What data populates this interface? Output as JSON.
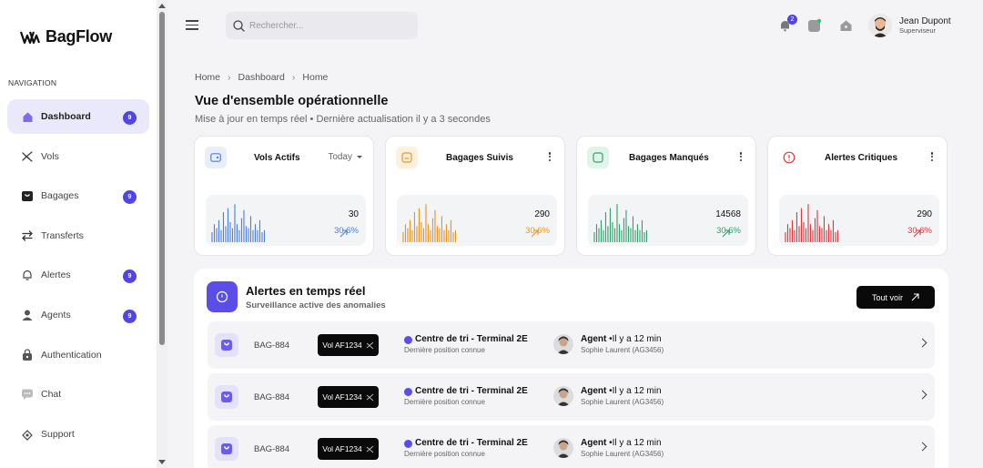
{
  "app": {
    "name": "BagFlow"
  },
  "sidebar": {
    "section_label": "NAVIGATION",
    "items": [
      {
        "label": "Dashboard",
        "icon": "home-icon",
        "badge": "9",
        "active": true
      },
      {
        "label": "Vols",
        "icon": "plane-icon",
        "badge": null
      },
      {
        "label": "Bagages",
        "icon": "bag-icon",
        "badge": "9"
      },
      {
        "label": "Transferts",
        "icon": "transfer-icon",
        "badge": null
      },
      {
        "label": "Alertes",
        "icon": "bell-icon",
        "badge": "9"
      },
      {
        "label": "Agents",
        "icon": "user-icon",
        "badge": "9"
      },
      {
        "label": "Authentication",
        "icon": "lock-icon",
        "badge": null
      },
      {
        "label": "Chat",
        "icon": "chat-icon",
        "badge": null
      },
      {
        "label": "Support",
        "icon": "support-icon",
        "badge": null
      }
    ]
  },
  "topbar": {
    "search_placeholder": "Rechercher...",
    "notification_count": "2",
    "user_name": "Jean Dupont",
    "user_role": "Superviseur"
  },
  "breadcrumb": [
    "Home",
    "Dashboard",
    "Home"
  ],
  "page": {
    "title": "Vue d'ensemble opérationnelle",
    "subtitle": "Mise à jour en temps réel • Dernière actualisation il y a 3 secondes"
  },
  "cards": [
    {
      "title": "Vols Actifs",
      "value": "30",
      "change": "30.6%",
      "color": "#4a7fe6",
      "icon_bg": "#e8eefb",
      "filter": "Today",
      "bars": [
        0.25,
        0.45,
        0.35,
        0.55,
        0.3,
        0.75,
        0.4,
        0.85,
        0.5,
        0.35,
        0.95,
        0.45,
        0.3,
        0.6,
        0.8,
        0.4,
        0.35,
        0.65,
        0.3,
        0.45,
        0.3,
        0.55,
        0.25,
        0.3
      ]
    },
    {
      "title": "Bagages Suivis",
      "value": "290",
      "change": "30.6%",
      "color": "#e8961e",
      "icon_bg": "#fdf0dd",
      "bars": [
        0.25,
        0.45,
        0.35,
        0.55,
        0.3,
        0.75,
        0.4,
        0.85,
        0.5,
        0.35,
        0.95,
        0.45,
        0.3,
        0.6,
        0.8,
        0.4,
        0.35,
        0.65,
        0.3,
        0.45,
        0.3,
        0.55,
        0.25,
        0.3
      ]
    },
    {
      "title": "Bagages Manqués",
      "value": "14568",
      "change": "30.6%",
      "color": "#2fa36b",
      "icon_bg": "#e1f4ea",
      "bars": [
        0.25,
        0.45,
        0.35,
        0.55,
        0.3,
        0.75,
        0.4,
        0.85,
        0.5,
        0.35,
        0.95,
        0.45,
        0.3,
        0.6,
        0.8,
        0.4,
        0.35,
        0.65,
        0.3,
        0.45,
        0.3,
        0.55,
        0.25,
        0.3
      ]
    },
    {
      "title": "Alertes Critiques",
      "value": "290",
      "change": "30.6%",
      "color": "#e0393e",
      "icon_bg": "#ffffff",
      "bars": [
        0.25,
        0.45,
        0.35,
        0.55,
        0.3,
        0.75,
        0.4,
        0.85,
        0.5,
        0.35,
        0.95,
        0.45,
        0.3,
        0.6,
        0.8,
        0.4,
        0.35,
        0.65,
        0.3,
        0.45,
        0.3,
        0.55,
        0.25,
        0.3
      ]
    }
  ],
  "alerts": {
    "title": "Alertes en temps réel",
    "subtitle": "Surveillance active des anomalies",
    "button": "Tout voir",
    "rows": [
      {
        "bag": "BAG-884",
        "flight": "Vol AF1234",
        "location": "Centre de tri - Terminal 2E",
        "location_sub": "Dernière position connue",
        "agent_label": "Agent",
        "time": "•Il y a 12 min",
        "agent_name": "Sophie Laurent (AG3456)"
      },
      {
        "bag": "BAG-884",
        "flight": "Vol AF1234",
        "location": "Centre de tri - Terminal 2E",
        "location_sub": "Dernière position connue",
        "agent_label": "Agent",
        "time": "•Il y a 12 min",
        "agent_name": "Sophie Laurent (AG3456)"
      },
      {
        "bag": "BAG-884",
        "flight": "Vol AF1234",
        "location": "Centre de tri - Terminal 2E",
        "location_sub": "Dernière position connue",
        "agent_label": "Agent",
        "time": "•Il y a 12 min",
        "agent_name": "Sophie Laurent (AG3456)"
      }
    ]
  },
  "colors": {
    "accent": "#4f46e5",
    "accent_light": "#e9e9fb",
    "dark": "#0a0a0a"
  }
}
